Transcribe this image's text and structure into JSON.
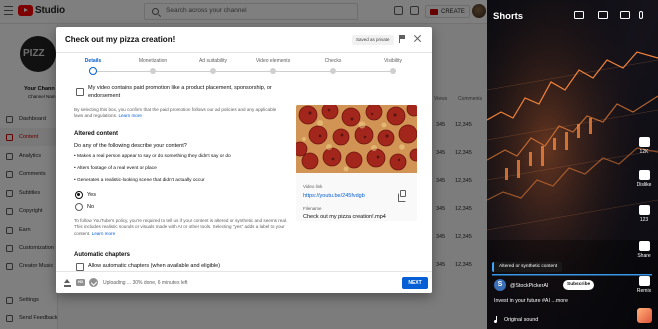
{
  "studio": {
    "logo_text": "Studio",
    "search_placeholder": "Search across your channel",
    "create_label": "CREATE",
    "channel_label": "Your Chann",
    "channel_name": "Channel Nam",
    "avatar_text": "PIZZ",
    "nav": [
      {
        "label": "Dashboard"
      },
      {
        "label": "Content",
        "active": true
      },
      {
        "label": "Analytics"
      },
      {
        "label": "Comments"
      },
      {
        "label": "Subtitles"
      },
      {
        "label": "Copyright"
      },
      {
        "label": "Earn"
      },
      {
        "label": "Customization"
      },
      {
        "label": "Creator Music"
      },
      {
        "label": "Settings"
      },
      {
        "label": "Send Feedback"
      }
    ],
    "table_headers": {
      "views": "Views",
      "comments": "Comments"
    },
    "table_rows": [
      {
        "date": "345",
        "views": "12,345",
        "comments": "12,345"
      },
      {
        "date": "345",
        "views": "12,345",
        "comments": "12,345"
      },
      {
        "date": "345",
        "views": "12,345",
        "comments": "12,345"
      },
      {
        "date": "345",
        "views": "12,345",
        "comments": "12,345"
      },
      {
        "date": "345",
        "views": "12,345",
        "comments": "12,345"
      },
      {
        "date": "345",
        "views": "12,345",
        "comments": "12,345"
      }
    ]
  },
  "dialog": {
    "title": "Check out my pizza creation!",
    "saved_badge": "Saved as private",
    "steps": [
      {
        "label": "Details",
        "active": true
      },
      {
        "label": "Monetization"
      },
      {
        "label": "Ad suitability"
      },
      {
        "label": "Video elements"
      },
      {
        "label": "Checks"
      },
      {
        "label": "Visibility"
      }
    ],
    "paid_promo_label": "My video contains paid promotion like a product placement, sponsorship, or endorsement",
    "paid_promo_note": "By selecting this box, you confirm that the paid promotion follows our ad policies and any applicable laws and regulations.",
    "learn_more": "Learn more",
    "altered_heading": "Altered content",
    "altered_question": "Do any of the following describe your content?",
    "altered_bullets": [
      "Makes a real person appear to say or do something they didn't say or do",
      "Alters footage of a real event or place",
      "Generates a realistic-looking scene that didn't actually occur"
    ],
    "radio_yes": "Yes",
    "radio_no": "No",
    "disclosure_note": "To follow YouTube's policy, you're required to tell us if your content is altered or synthetic and seems real. This includes realistic sounds or visuals made with AI or other tools. Selecting \"yes\" adds a label to your content.",
    "chapters_heading": "Automatic chapters",
    "chapters_label": "Allow automatic chapters (when available and eligible)",
    "video_link_label": "Video link",
    "video_link": "https://youtu.be/245fvdgb",
    "filename_label": "Filename",
    "filename": "Check out my pizza creation!.mp4",
    "upload_status": "Uploading ... 30% done, 6 minutes left",
    "next_label": "NEXT"
  },
  "shorts": {
    "title": "Shorts",
    "actions": [
      {
        "icon": "like-icon",
        "label": "12K"
      },
      {
        "icon": "dislike-icon",
        "label": "Dislike"
      },
      {
        "icon": "comment-icon",
        "label": "123"
      },
      {
        "icon": "share-icon",
        "label": "Share"
      },
      {
        "icon": "remix-icon",
        "label": "Remix"
      }
    ],
    "altered_badge": "Altered or synthetic content",
    "channel_avatar": "S",
    "channel_handle": "@StockPickerAI",
    "subscribe_label": "Subscribe",
    "caption": "Invest in your future #AI ...more",
    "sound": "Original sound"
  },
  "colors": {
    "brand_red": "#ff0000",
    "accent_blue": "#065fd4",
    "chart_orange": "#ff8a3d"
  }
}
